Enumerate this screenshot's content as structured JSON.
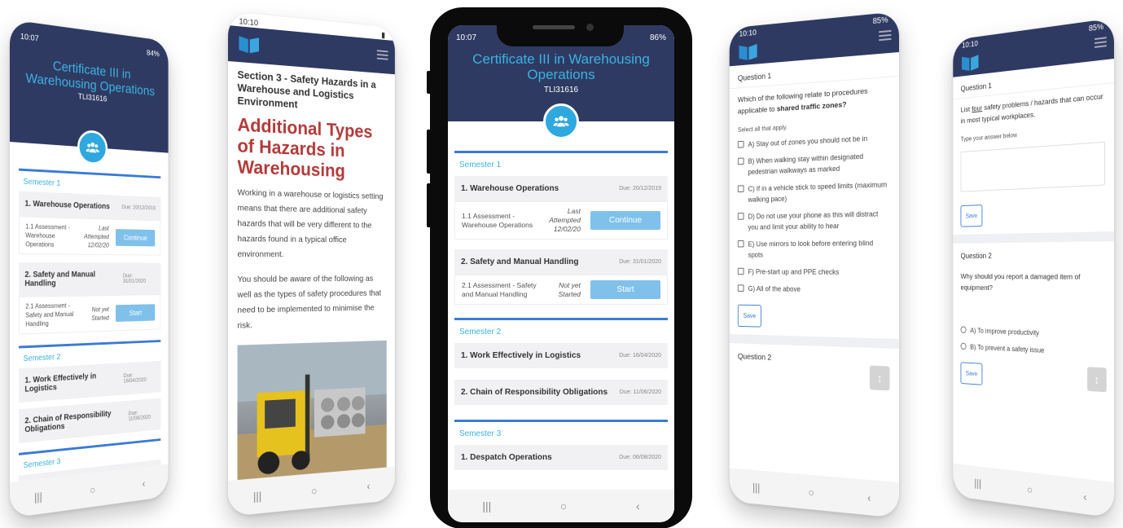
{
  "course": {
    "title": "Certificate III in Warehousing Operations",
    "code": "TLI31616"
  },
  "center_status": {
    "time": "10:07",
    "battery": "86%"
  },
  "semesters": [
    {
      "label": "Semester 1",
      "units": [
        {
          "name": "1. Warehouse Operations",
          "due": "Due: 20/12/2019",
          "assessment": {
            "name": "1.1 Assessment - Warehouse Operations",
            "status": "Last Attempted 12/02/20",
            "action": "Continue"
          }
        },
        {
          "name": "2. Safety and Manual Handling",
          "due": "Due: 31/01/2020",
          "assessment": {
            "name": "2.1 Assessment - Safety and Manual Handling",
            "status": "Not yet Started",
            "action": "Start"
          }
        }
      ]
    },
    {
      "label": "Semester 2",
      "units": [
        {
          "name": "1. Work Effectively in Logistics",
          "due": "Due: 16/04/2020"
        },
        {
          "name": "2. Chain of Responsibility Obligations",
          "due": "Due: 11/06/2020"
        }
      ]
    },
    {
      "label": "Semester 3",
      "units": [
        {
          "name": "1. Despatch Operations",
          "due": "Due: 06/08/2020"
        }
      ]
    }
  ],
  "far_left_status": {
    "time": "10:07",
    "battery": "84%"
  },
  "section_phone": {
    "time": "10:10",
    "heading": "Section 3 - Safety Hazards in a Warehouse and Logistics Environment",
    "big_title": "Additional Types of Hazards in Warehousing",
    "para1": "Working in a warehouse or logistics setting means that there are additional safety hazards that will be very different to the hazards found in a typical office environment.",
    "para2": "You should be aware of the following as well as the types of safety procedures that need to be implemented to minimise the risk."
  },
  "question_phone": {
    "time": "10:10",
    "battery": "85%",
    "q_title": "Question 1",
    "q_text_pre": "Which of the following relate to procedures applicable to ",
    "q_text_bold": "shared traffic zones?",
    "select_hint": "Select all that apply.",
    "options": [
      "A) Stay out of zones you should not be in",
      "B) When walking stay within designated pedestrian walkways as marked",
      "C) If in a vehicle stick to speed limits (maximum walking pace)",
      "D) Do not use your phone as this will distract you and limit your ability to hear",
      "E) Use mirrors to look before entering blind spots",
      "F) Pre-start up and PPE checks",
      "G) All of the above"
    ],
    "save": "Save",
    "next_title": "Question 2"
  },
  "far_right_phone": {
    "time": "10:10",
    "battery": "85%",
    "q1_title": "Question 1",
    "q1_pre": "List ",
    "q1_underline": "four",
    "q1_post": " safety problems / hazards that can occur in most typical workplaces.",
    "q1_hint": "Type your answer below",
    "save": "Save",
    "q2_title": "Question 2",
    "q2_text": "Why should you report a damaged item of equipment?",
    "q2_options": [
      "A) To improve productivity",
      "B) To prevent a safety issue"
    ]
  },
  "nav": {
    "recent": "|||",
    "home": "○",
    "back": "‹"
  },
  "icons": {
    "badge": "people-icon",
    "scroll": "scroll-handle-icon"
  }
}
